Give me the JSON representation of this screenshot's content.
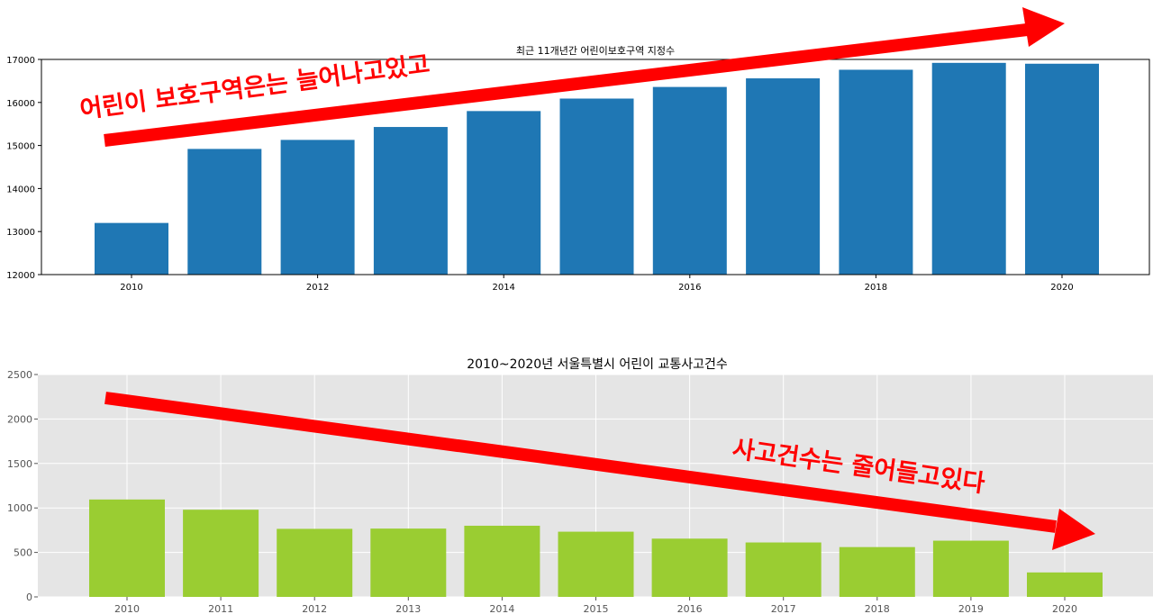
{
  "chart_data": [
    {
      "type": "bar",
      "title": "최근 11개년간 어린이보호구역 지정수",
      "x": [
        2010,
        2011,
        2012,
        2013,
        2014,
        2015,
        2016,
        2017,
        2018,
        2019,
        2020
      ],
      "values": [
        13200,
        14920,
        15130,
        15430,
        15800,
        16090,
        16360,
        16560,
        16760,
        16920,
        16900
      ],
      "xticks": [
        "2010",
        "2012",
        "2014",
        "2016",
        "2018",
        "2020"
      ],
      "yticks": [
        "12000",
        "13000",
        "14000",
        "15000",
        "16000",
        "17000"
      ],
      "ylim": [
        12000,
        17000
      ],
      "grid": false,
      "bar_color": "#1f77b4",
      "annotation": "어린이 보호구역은는 늘어나고있고",
      "annotation_color": "#ff0000",
      "trend": "up"
    },
    {
      "type": "bar",
      "title": "2010~2020년 서울특별시 어린이 교통사고건수",
      "categories": [
        "2010",
        "2011",
        "2012",
        "2013",
        "2014",
        "2015",
        "2016",
        "2017",
        "2018",
        "2019",
        "2020"
      ],
      "values": [
        1095,
        980,
        765,
        768,
        800,
        733,
        655,
        612,
        560,
        632,
        275
      ],
      "yticks": [
        "0",
        "500",
        "1000",
        "1500",
        "2000",
        "2500"
      ],
      "ylim": [
        0,
        2500
      ],
      "grid": true,
      "background": "#e5e5e5",
      "bar_color": "#9acd32",
      "annotation": "사고건수는 줄어들고있다",
      "annotation_color": "#ff0000",
      "trend": "down"
    }
  ]
}
